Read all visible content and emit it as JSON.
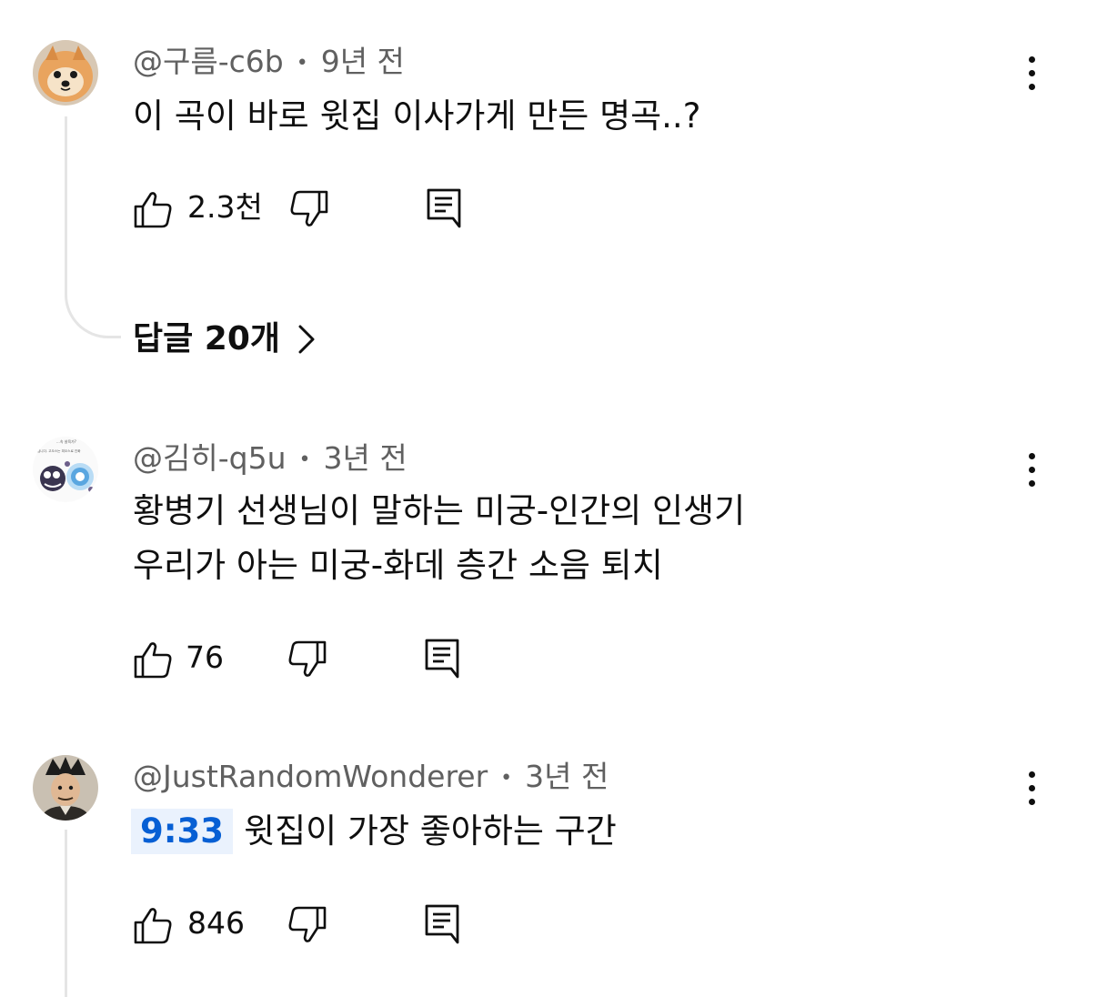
{
  "comments": [
    {
      "handle": "@구름-c6b",
      "age": "9년 전",
      "lines": [
        "이 곡이 바로 윗집 이사가게 만든 명곡..?"
      ],
      "likes": "2.3천",
      "replies_label": "답글 20개",
      "avatar": "pomeranian-dog-avatar"
    },
    {
      "handle": "@김히-q5u",
      "age": "3년 전",
      "lines": [
        "황병기 선생님이 말하는 미궁-인간의 인생기",
        "우리가 아는 미궁-화데 층간 소음 퇴치"
      ],
      "likes": "76",
      "avatar": "pokemon-cartoon-avatar",
      "avatar_caption_top": "...속 살육가?",
      "avatar_caption_bottom": "겁니다. 고오스는 피오스로 진화"
    },
    {
      "handle": "@JustRandomWonderer",
      "age": "3년 전",
      "timestamp": "9:33",
      "text": "윗집이 가장 좋아하는 구간",
      "likes": "846",
      "avatar": "traditional-costume-man-avatar"
    }
  ],
  "separator": "•",
  "icons": {
    "like": "thumbs-up-icon",
    "dislike": "thumbs-down-icon",
    "reply": "comment-reply-icon",
    "menu": "more-vertical-icon",
    "chevron": "chevron-right-icon"
  },
  "colors": {
    "text": "#0f0f0f",
    "meta": "#606060",
    "timestamp_link": "#065fd4",
    "timestamp_bg": "#eaf2fd",
    "thread_line": "#e5e5e5"
  }
}
